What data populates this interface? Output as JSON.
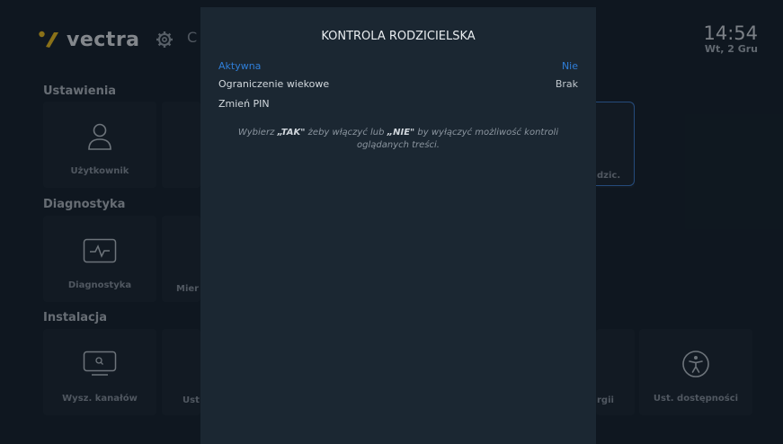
{
  "header": {
    "brand": "vectra",
    "search_hint": "C",
    "time": "14:54",
    "date": "Wt, 2 Gru"
  },
  "sections": {
    "settings": {
      "title": "Ustawienia",
      "tiles": [
        "Użytkownik",
        "",
        "",
        "",
        "",
        "dzic."
      ]
    },
    "diagnostics": {
      "title": "Diagnostyka",
      "tiles": [
        "Diagnostyka",
        "Mier"
      ]
    },
    "installation": {
      "title": "Instalacja",
      "tiles": [
        "Wysz. kanałów",
        "Ust",
        "rgii",
        "Ust. dostępności"
      ]
    }
  },
  "modal": {
    "title": "KONTROLA RODZICIELSKA",
    "rows": [
      {
        "label": "Aktywna",
        "value": "Nie"
      },
      {
        "label": "Ograniczenie wiekowe",
        "value": "Brak"
      },
      {
        "label": "Zmień PIN",
        "value": ""
      }
    ],
    "help_parts": {
      "p1": "Wybierz ",
      "tak": "„TAK\"",
      "p2": " żeby włączyć lub ",
      "nie": "„NIE\"",
      "p3": " by wyłączyć możliwość kontroli oglądanych treści."
    }
  },
  "colors": {
    "accent": "#2f7ed8",
    "logo_yellow": "#f5c31d",
    "background": "#15202a",
    "modal_bg": "#1b2732"
  }
}
